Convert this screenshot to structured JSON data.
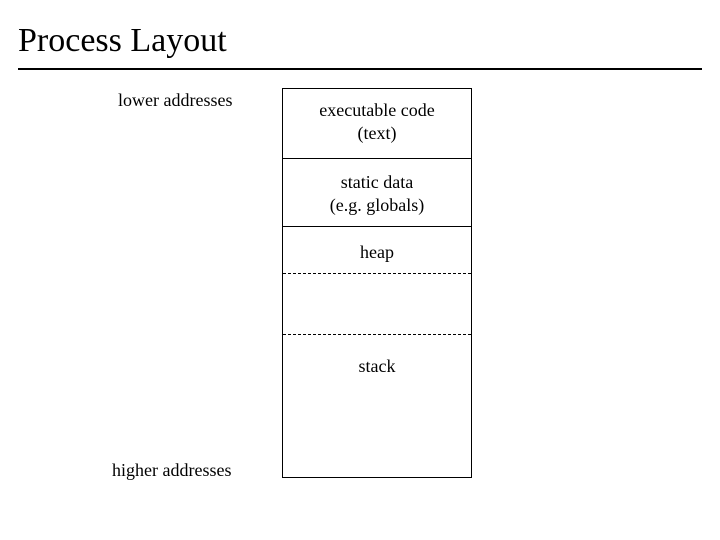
{
  "title": "Process Layout",
  "labels": {
    "lower": "lower addresses",
    "higher": "higher addresses"
  },
  "segments": {
    "text_line1": "executable code",
    "text_line2": "(text)",
    "static_line1": "static data",
    "static_line2": "(e.g. globals)",
    "heap": "heap",
    "stack": "stack"
  }
}
